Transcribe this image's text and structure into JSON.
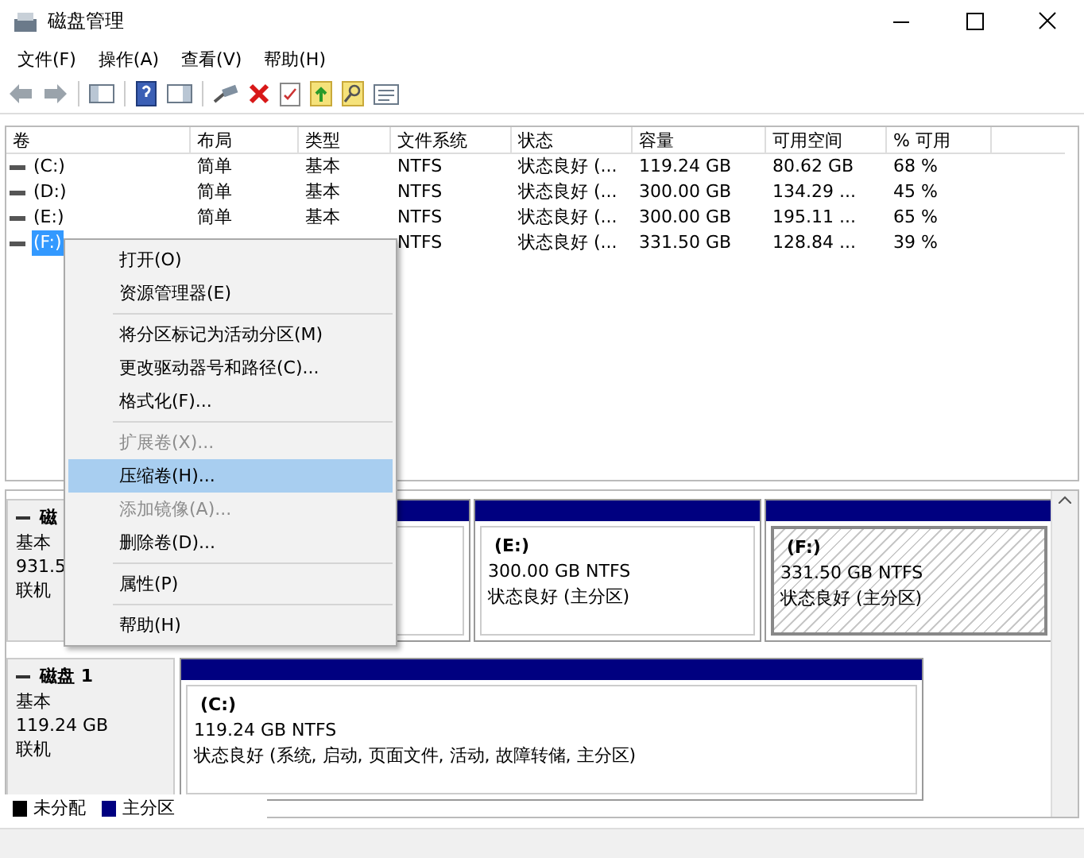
{
  "window": {
    "title": "磁盘管理"
  },
  "menu": [
    {
      "label": "文件(F)"
    },
    {
      "label": "操作(A)"
    },
    {
      "label": "查看(V)"
    },
    {
      "label": "帮助(H)"
    }
  ],
  "toolbar": [
    {
      "kind": "back"
    },
    {
      "kind": "forward"
    },
    {
      "kind": "sep"
    },
    {
      "kind": "panel"
    },
    {
      "kind": "sep"
    },
    {
      "kind": "help"
    },
    {
      "kind": "panel2"
    },
    {
      "kind": "sep"
    },
    {
      "kind": "connect"
    },
    {
      "kind": "delete"
    },
    {
      "kind": "check"
    },
    {
      "kind": "folder-up"
    },
    {
      "kind": "folder-search"
    },
    {
      "kind": "list"
    }
  ],
  "volume_list": {
    "columns": [
      "卷",
      "布局",
      "类型",
      "文件系统",
      "状态",
      "容量",
      "可用空间",
      "% 可用"
    ],
    "rows": [
      {
        "selected": false,
        "cells": [
          "(C:)",
          "简单",
          "基本",
          "NTFS",
          "状态良好 (...",
          "119.24 GB",
          "80.62 GB",
          "68 %"
        ]
      },
      {
        "selected": false,
        "cells": [
          "(D:)",
          "简单",
          "基本",
          "NTFS",
          "状态良好 (...",
          "300.00 GB",
          "134.29 ...",
          "45 %"
        ]
      },
      {
        "selected": false,
        "cells": [
          "(E:)",
          "简单",
          "基本",
          "NTFS",
          "状态良好 (...",
          "300.00 GB",
          "195.11 ...",
          "65 %"
        ]
      },
      {
        "selected": true,
        "cells": [
          "(F:)",
          null,
          null,
          "NTFS",
          "状态良好 (...",
          "331.50 GB",
          "128.84 ...",
          "39 %"
        ]
      }
    ]
  },
  "disks": [
    {
      "name": "磁",
      "type": "基本",
      "size": "931.5",
      "status": "联机",
      "partitions": [
        {
          "selected": false
        },
        {
          "selected": false,
          "label": "(E:)",
          "size": "300.00 GB NTFS",
          "status": "状态良好 (主分区)"
        },
        {
          "selected": true,
          "label": "(F:)",
          "size": "331.50 GB NTFS",
          "status": "状态良好 (主分区)"
        }
      ]
    },
    {
      "name": "磁盘 1",
      "type": "基本",
      "size": "119.24 GB",
      "status": "联机",
      "partitions": [
        {
          "selected": false,
          "label": "(C:)",
          "size": "119.24 GB NTFS",
          "status": "状态良好 (系统, 启动, 页面文件, 活动, 故障转储, 主分区)"
        }
      ]
    }
  ],
  "legend": [
    {
      "label": "未分配",
      "color": "#000000"
    },
    {
      "label": "主分区",
      "color": "#000080"
    }
  ],
  "context_menu": {
    "groups": [
      [
        {
          "label": "打开(O)",
          "disabled": false,
          "selected": false
        },
        {
          "label": "资源管理器(E)",
          "disabled": false,
          "selected": false
        }
      ],
      [
        {
          "label": "将分区标记为活动分区(M)",
          "disabled": false,
          "selected": false
        },
        {
          "label": "更改驱动器号和路径(C)...",
          "disabled": false,
          "selected": false
        },
        {
          "label": "格式化(F)...",
          "disabled": false,
          "selected": false
        }
      ],
      [
        {
          "label": "扩展卷(X)...",
          "disabled": true,
          "selected": false
        },
        {
          "label": "压缩卷(H)...",
          "disabled": false,
          "selected": true
        },
        {
          "label": "添加镜像(A)...",
          "disabled": true,
          "selected": false
        },
        {
          "label": "删除卷(D)...",
          "disabled": false,
          "selected": false
        }
      ],
      [
        {
          "label": "属性(P)",
          "disabled": false,
          "selected": false
        }
      ],
      [
        {
          "label": "帮助(H)",
          "disabled": false,
          "selected": false
        }
      ]
    ]
  }
}
